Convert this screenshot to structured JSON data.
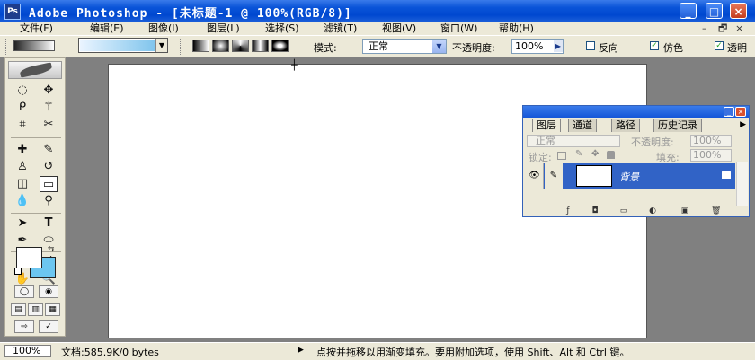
{
  "window": {
    "title": "Adobe Photoshop - [未标题-1 @ 100%(RGB/8)]",
    "app_icon": "Ps",
    "controls": {
      "minimize": "_",
      "maximize": "□",
      "close": "×"
    }
  },
  "menu": {
    "items": [
      "文件(F)",
      "编辑(E)",
      "图像(I)",
      "图层(L)",
      "选择(S)",
      "滤镜(T)",
      "视图(V)",
      "窗口(W)",
      "帮助(H)"
    ],
    "doc_controls": {
      "minimize": "–",
      "restore": "🗗",
      "close": "×"
    }
  },
  "options": {
    "gradient_types": [
      "linear",
      "radial",
      "angle",
      "reflected",
      "diamond"
    ],
    "mode_label": "模式:",
    "mode_value": "正常",
    "opacity_label": "不透明度:",
    "opacity_value": "100%",
    "reverse_label": "反向",
    "reverse_checked": false,
    "dither_label": "仿色",
    "dither_checked": true,
    "transparency_label": "透明",
    "transparency_checked": true,
    "check_mark": "✓"
  },
  "tools": {
    "active": "gradient-tool",
    "glyphs": {
      "marquee": "◌",
      "move": "✥",
      "lasso": "ᑭ",
      "magic_wand": "⚚",
      "crop": "⌗",
      "slice": "✂",
      "healing": "✚",
      "brush": "✎",
      "stamp": "♙",
      "history_brush": "↺",
      "eraser": "◫",
      "gradient": "▭",
      "blur": "💧",
      "dodge": "⚲",
      "path_select": "➤",
      "type": "T",
      "pen": "✒",
      "shape": "⬭",
      "notes": "✉",
      "eyedropper": "⁄",
      "hand": "✋",
      "zoom": "🔍"
    }
  },
  "colors": {
    "foreground": "#ffffff",
    "background": "#6cc6f0"
  },
  "layers_panel": {
    "tabs": [
      "图层",
      "通道",
      "路径",
      "历史记录"
    ],
    "blend_mode": "正常",
    "opacity_label": "不透明度:",
    "opacity_value": "100%",
    "lock_label": "锁定:",
    "fill_label": "填充:",
    "fill_value": "100%",
    "layer_name": "背景",
    "eye_glyph": "👁",
    "brush_glyph": "✎"
  },
  "status": {
    "zoom": "100%",
    "doc_info": "文档:585.9K/0 bytes",
    "arrow": "▶",
    "message": "点按并拖移以用渐变填充。要用附加选项，使用 Shift、Alt 和 Ctrl 键。"
  }
}
